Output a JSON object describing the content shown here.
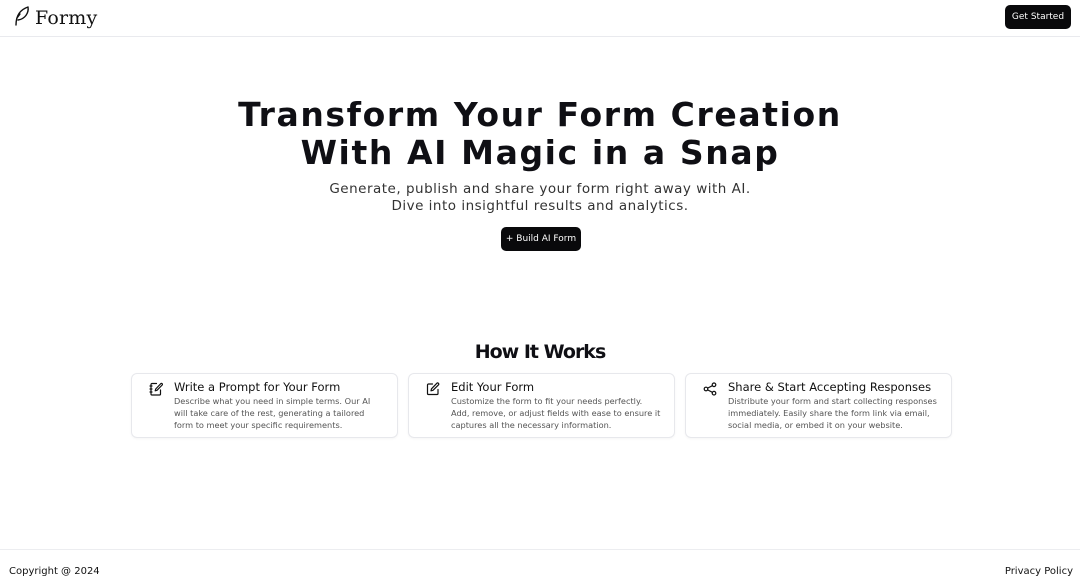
{
  "header": {
    "logo_text": "Formy",
    "logo_icon": "feather-icon",
    "get_started_label": "Get Started"
  },
  "hero": {
    "title_line1": "Transform Your Form Creation",
    "title_line2": "With AI Magic in a Snap",
    "subtitle_line1": "Generate, publish and share your form right away with AI.",
    "subtitle_line2": "Dive into insightful results and analytics.",
    "build_button_label": "+ Build AI Form"
  },
  "how_it_works": {
    "title": "How It Works",
    "cards": [
      {
        "icon": "notebook-pen-icon",
        "title": "Write a Prompt for Your Form",
        "description": "Describe what you need in simple terms. Our AI will take care of the rest, generating a tailored form to meet your specific requirements."
      },
      {
        "icon": "edit-icon",
        "title": "Edit Your Form",
        "description": "Customize the form to fit your needs perfectly. Add, remove, or adjust fields with ease to ensure it captures all the necessary information."
      },
      {
        "icon": "share-icon",
        "title": "Share & Start Accepting Responses",
        "description": "Distribute your form and start collecting responses immediately. Easily share the form link via email, social media, or embed it on your website."
      }
    ]
  },
  "footer": {
    "copyright": "Copyright @ 2024",
    "privacy_label": "Privacy Policy"
  },
  "colors": {
    "button_bg": "#09090b",
    "border": "#e7e8ec"
  }
}
